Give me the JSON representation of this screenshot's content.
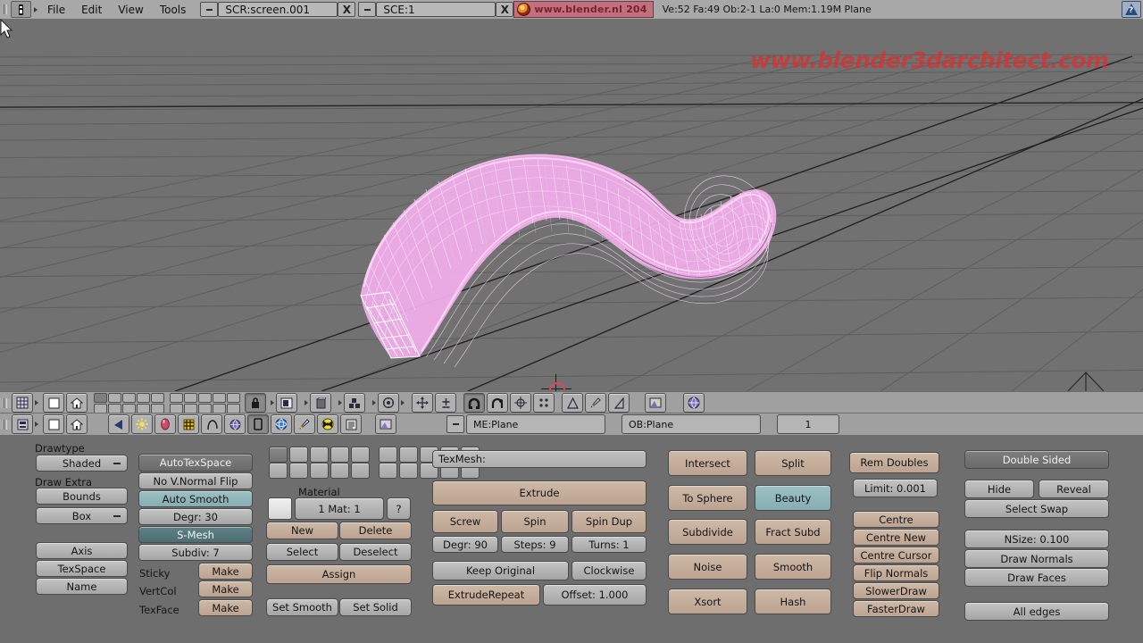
{
  "window": {
    "app": "Blender",
    "watermark": "www.blender3darchitect.com"
  },
  "topbar": {
    "window_type_icon": "blender-window-type-icon",
    "menus": [
      "File",
      "Edit",
      "View",
      "Tools"
    ],
    "screen": {
      "dash": "screen-menu-icon",
      "value": "SCR:screen.001",
      "close": "X"
    },
    "scene": {
      "dash": "scene-menu-icon",
      "value": "SCE:1",
      "close": "X"
    },
    "brand": {
      "icon": "blender-logo-icon",
      "url": "www.blender.nl",
      "version": "204"
    },
    "stats": "Ve:52 Fa:49 Ob:2-1 La:0 Mem:1.19M  Plane",
    "help_icon": "help-question-icon"
  },
  "viewport": {
    "background": "#717171",
    "grid_color": "#5f5f5f",
    "axis_color": "#2b2b2b",
    "mesh_color": "#f0a8e8",
    "cursor_icon": "3d-cursor-icon",
    "mouse_icon": "mouse-pointer-icon"
  },
  "header_row1": {
    "window_type_icon": "view3d-window-type-icon",
    "full_icon": "full-screen-icon",
    "home_icon": "home-icon",
    "lock_icon": "lock-icon",
    "layers": {
      "rows": 2,
      "cols": 10,
      "selected": 0
    },
    "icons": [
      "viewmode-object-icon",
      "viewmode-solid-icon",
      "viewmode-editmode-icon",
      "viewmode-vertexpaint-icon",
      "translate-manipulator-icon",
      "axis-constrain-icon",
      "magnet-snap-icon",
      "magnet-snap-alt-icon",
      "rotate-pivot-icon",
      "proportional-edit-icon",
      "cone-icon",
      "brush-icon",
      "triangle-icon",
      "render-preview-icon",
      "globe-icon"
    ]
  },
  "header_row2": {
    "window_type_icon": "buttons-window-type-icon",
    "full_icon": "full-screen-icon",
    "home_icon": "home-icon",
    "icons": [
      "lamp-icon",
      "material-icon",
      "texture-icon",
      "anim-icon",
      "world-icon",
      "object-icon",
      "physics-icon",
      "edit-pencil-icon",
      "radiosity-icon",
      "script-icon",
      "display-icon"
    ],
    "dash": "mesh-menu-icon",
    "mesh_name": "ME:Plane",
    "object_name": "OB:Plane",
    "users": "1"
  },
  "panel": {
    "mesh_col": {
      "drawtype_label": "Drawtype",
      "drawtype_value": "Shaded",
      "draw_extra_label": "Draw Extra",
      "bounds": "Bounds",
      "box": "Box",
      "axis": "Axis",
      "texspace": "TexSpace",
      "name": "Name"
    },
    "mesh_opts": {
      "auto_tex_space": "AutoTexSpace",
      "no_v_normal_flip": "No V.Normal Flip",
      "auto_smooth": "Auto Smooth",
      "degr": "Degr: 30",
      "s_mesh": "S-Mesh",
      "subdiv": "Subdiv: 7",
      "sticky_label": "Sticky",
      "sticky_btn": "Make",
      "vertcol_label": "VertCol",
      "vertcol_btn": "Make",
      "texface_label": "TexFace",
      "texface_btn": "Make"
    },
    "material": {
      "title": "Material",
      "index": "1 Mat: 1",
      "help": "?",
      "new": "New",
      "delete": "Delete",
      "select": "Select",
      "deselect": "Deselect",
      "assign": "Assign",
      "set_smooth": "Set Smooth",
      "set_solid": "Set Solid",
      "layers_selected": 0
    },
    "tools": {
      "texmesh": "TexMesh:",
      "extrude": "Extrude",
      "screw": "Screw",
      "spin": "Spin",
      "spin_dup": "Spin Dup",
      "degr": "Degr: 90",
      "steps": "Steps: 9",
      "turns": "Turns: 1",
      "keep_original": "Keep Original",
      "clockwise": "Clockwise",
      "extrude_repeat": "ExtrudeRepeat",
      "offset": "Offset: 1.000"
    },
    "mesh_ops": [
      [
        "Intersect",
        "Split"
      ],
      [
        "To Sphere",
        "Beauty"
      ],
      [
        "Subdivide",
        "Fract Subd"
      ],
      [
        "Noise",
        "Smooth"
      ],
      [
        "Xsort",
        "Hash"
      ]
    ],
    "centre": {
      "rem_doubles": "Rem Doubles",
      "limit": "Limit: 0.001",
      "items": [
        "Centre",
        "Centre New",
        "Centre Cursor",
        "Flip Normals",
        "SlowerDraw",
        "FasterDraw"
      ]
    },
    "display": {
      "double_sided": "Double Sided",
      "hide": "Hide",
      "reveal": "Reveal",
      "select_swap": "Select Swap",
      "nsize": "NSize: 0.100",
      "draw_normals": "Draw Normals",
      "draw_faces": "Draw Faces",
      "all_edges": "All edges"
    }
  }
}
